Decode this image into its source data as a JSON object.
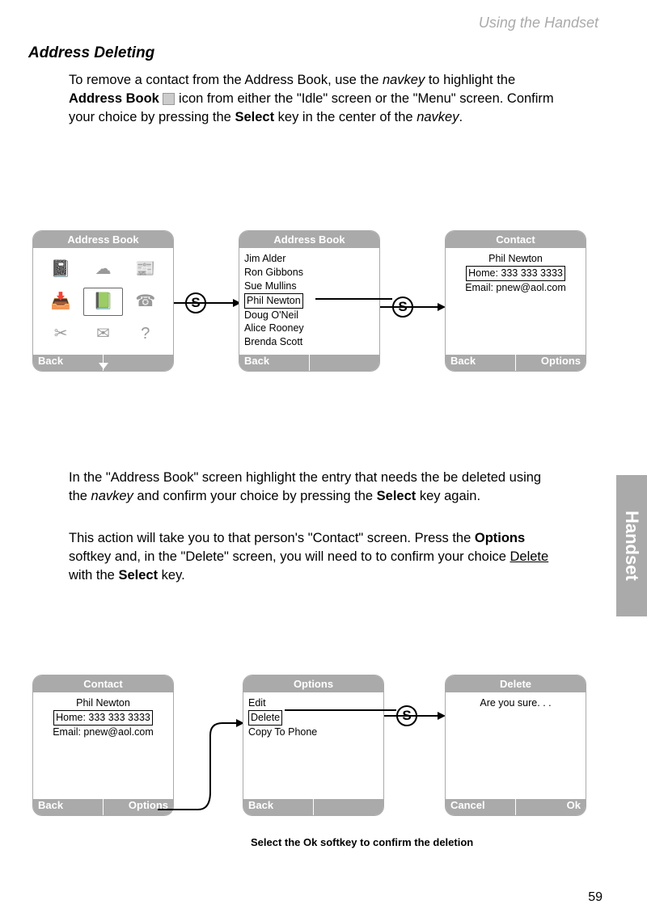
{
  "header": {
    "right": "Using the Handset"
  },
  "section": {
    "title": "Address Deleting"
  },
  "para1": {
    "t1": "To remove a contact from the Address Book, use the ",
    "navkey": "navkey",
    "t2": " to highlight the ",
    "ab": "Address Book",
    "t3": " icon from either the \"Idle\" screen or the \"Menu\" screen. Confirm your choice by pressing the ",
    "select": "Select",
    "t4": " key in the center of the ",
    "navkey2": "navkey",
    "t5": "."
  },
  "para2": {
    "t1": "In the \"Address Book\" screen highlight the entry that needs the be deleted using the ",
    "navkey": "navkey",
    "t2": " and confirm your choice by pressing the ",
    "select": "Select",
    "t3": " key again."
  },
  "para3": {
    "t1": "This action will take you to that person's \"Contact\" screen. Press the ",
    "options": "Options",
    "t2": " softkey and, in the \"Delete\" screen, you will need to to confirm your choice ",
    "delete": "Delete",
    "t3": " with the ",
    "select": "Select",
    "t4": " key."
  },
  "screens": {
    "s1": {
      "title": "Address Book",
      "soft_left": "Back",
      "soft_right": ""
    },
    "s2": {
      "title": "Address Book",
      "soft_left": "Back",
      "soft_right": "",
      "contacts": [
        "Jim Alder",
        "Ron Gibbons",
        "Sue Mullins",
        "Phil Newton",
        "Doug O'Neil",
        "Alice Rooney",
        "Brenda Scott"
      ],
      "highlighted": "Phil Newton"
    },
    "s3": {
      "title": "Contact",
      "soft_left": "Back",
      "soft_right": "Options",
      "name": "Phil Newton",
      "home": "Home: 333 333 3333",
      "email": "Email: pnew@aol.com"
    },
    "s4": {
      "title": "Contact",
      "soft_left": "Back",
      "soft_right": "Options",
      "name": "Phil Newton",
      "home": "Home: 333 333 3333",
      "email": "Email: pnew@aol.com"
    },
    "s5": {
      "title": "Options",
      "soft_left": "Back",
      "soft_right": "",
      "items": [
        "Edit",
        "Delete",
        "Copy To Phone"
      ],
      "highlighted": "Delete"
    },
    "s6": {
      "title": "Delete",
      "soft_left": "Cancel",
      "soft_right": "Ok",
      "msg": "Are you sure. . ."
    }
  },
  "nav_label": "S",
  "caption": "Select the Ok softkey to confirm the deletion",
  "side_tab": "Handset",
  "page": "59",
  "icons": {
    "grid": [
      "📓",
      "☁",
      "📰",
      "📥",
      "📗",
      "☎",
      "✂",
      "✉",
      "?"
    ]
  }
}
